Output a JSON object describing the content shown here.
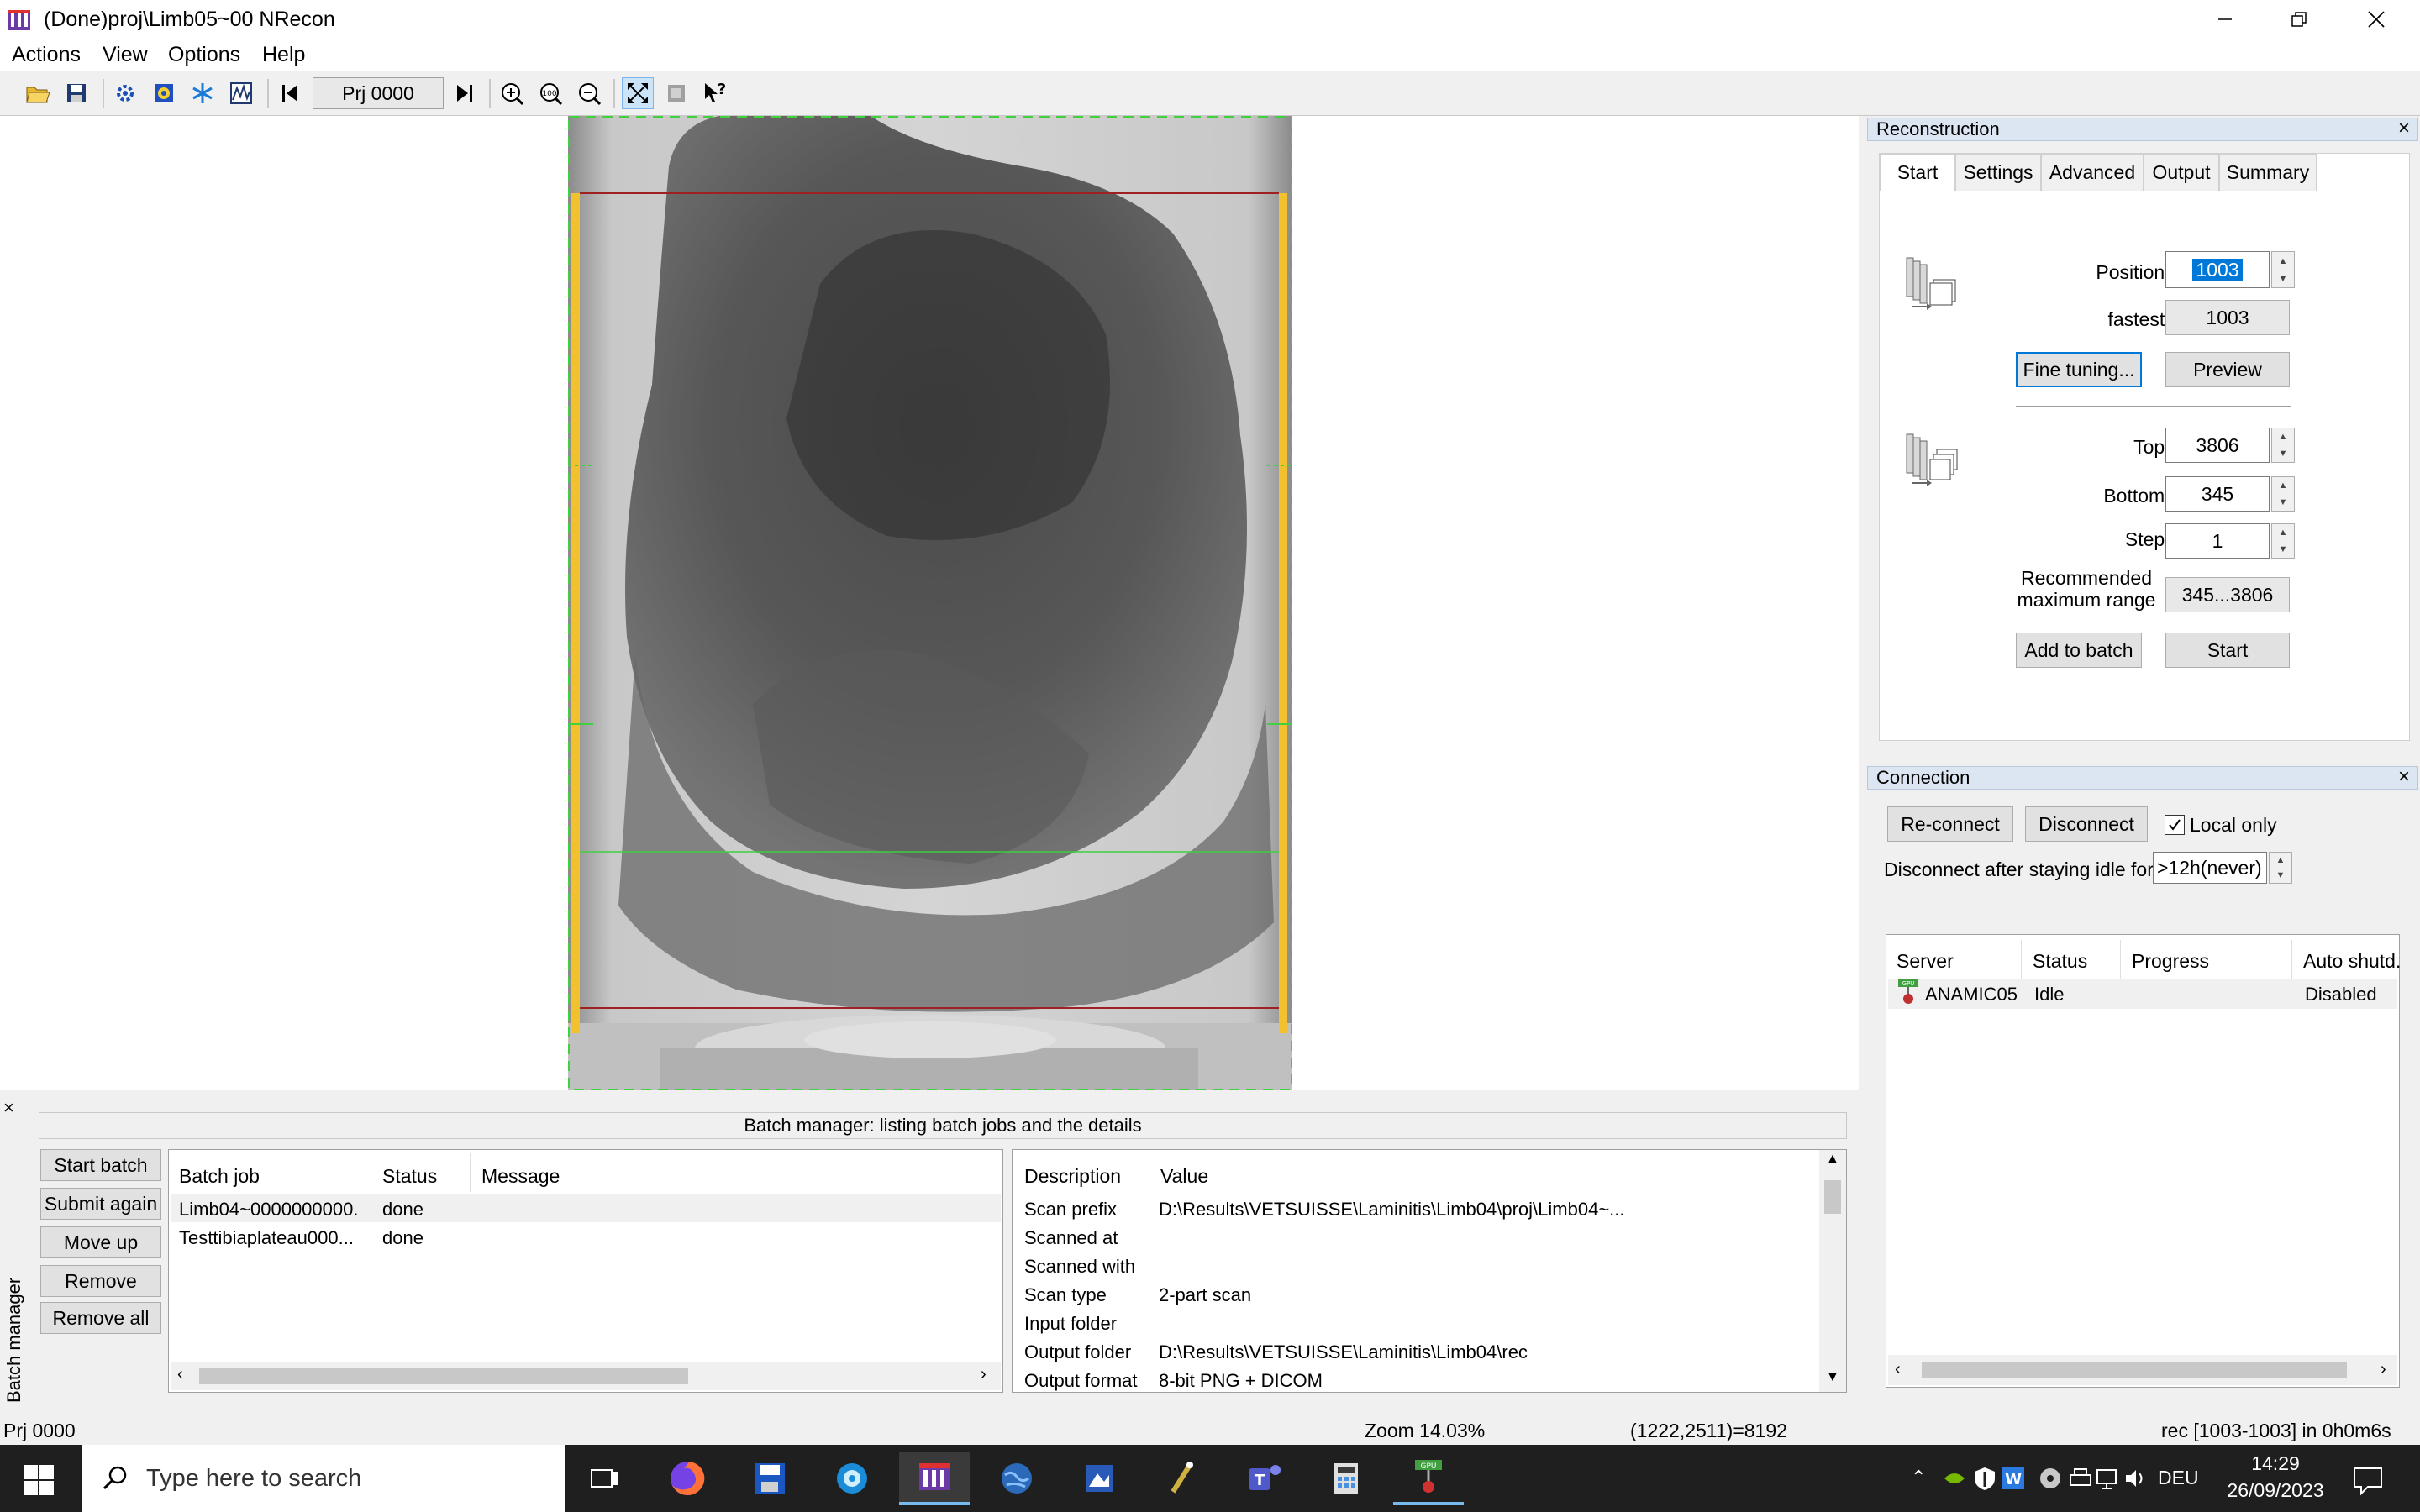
{
  "window": {
    "title": "(Done)proj\\Limb05~00  NRecon"
  },
  "menu": [
    "Actions",
    "View",
    "Options",
    "Help"
  ],
  "toolbar": {
    "projection": "Prj 0000"
  },
  "reconstruction": {
    "title": "Reconstruction",
    "tabs": [
      "Start",
      "Settings",
      "Advanced",
      "Output",
      "Summary"
    ],
    "position_label": "Position :",
    "position_value": "1003",
    "fastest_label": "fastest :",
    "fastest_value": "1003",
    "fine_tuning": "Fine tuning...",
    "preview": "Preview",
    "top_label": "Top :",
    "top_value": "3806",
    "bottom_label": "Bottom :",
    "bottom_value": "345",
    "step_label": "Step :",
    "step_value": "1",
    "recommended_label_1": "Recommended",
    "recommended_label_2": "maximum range",
    "recommended_value": "345...3806",
    "add_to_batch": "Add to batch",
    "start": "Start"
  },
  "connection": {
    "title": "Connection",
    "reconnect": "Re-connect",
    "disconnect": "Disconnect",
    "local_only": "Local only",
    "local_only_checked": true,
    "idle_label": "Disconnect after staying idle for",
    "idle_value": ">12h(never)",
    "columns": [
      "Server",
      "Status",
      "Progress",
      "Auto shutd."
    ],
    "servers": [
      {
        "server": "ANAMIC05",
        "status": "Idle",
        "progress": "",
        "auto": "Disabled"
      }
    ]
  },
  "batch": {
    "side_label": "Batch manager",
    "header": "Batch manager:  listing batch jobs and the details",
    "buttons": [
      "Start batch",
      "Submit again",
      "Move up",
      "Remove",
      "Remove all"
    ],
    "jobs_columns": [
      "Batch job",
      "Status",
      "Message"
    ],
    "jobs": [
      {
        "job": "Limb04~0000000000.",
        "status": "done",
        "message": ""
      },
      {
        "job": "Testtibiaplateau000...",
        "status": "done",
        "message": ""
      }
    ],
    "detail_columns": [
      "Description",
      "Value"
    ],
    "details": [
      {
        "desc": "Scan prefix",
        "value": "D:\\Results\\VETSUISSE\\Laminitis\\Limb04\\proj\\Limb04~..."
      },
      {
        "desc": "Scanned at",
        "value": ""
      },
      {
        "desc": "Scanned with",
        "value": ""
      },
      {
        "desc": "Scan type",
        "value": "2-part scan"
      },
      {
        "desc": "Input folder",
        "value": ""
      },
      {
        "desc": "Output folder",
        "value": "D:\\Results\\VETSUISSE\\Laminitis\\Limb04\\rec"
      },
      {
        "desc": "Output format",
        "value": "8-bit PNG + DICOM"
      }
    ]
  },
  "status": {
    "left": "Prj 0000",
    "zoom": "Zoom 14.03%",
    "coords": "(1222,2511)=8192",
    "right": "rec [1003-1003] in 0h0m6s"
  },
  "taskbar": {
    "search_placeholder": "Type here to search",
    "language": "DEU",
    "time": "14:29",
    "date": "26/09/2023"
  }
}
